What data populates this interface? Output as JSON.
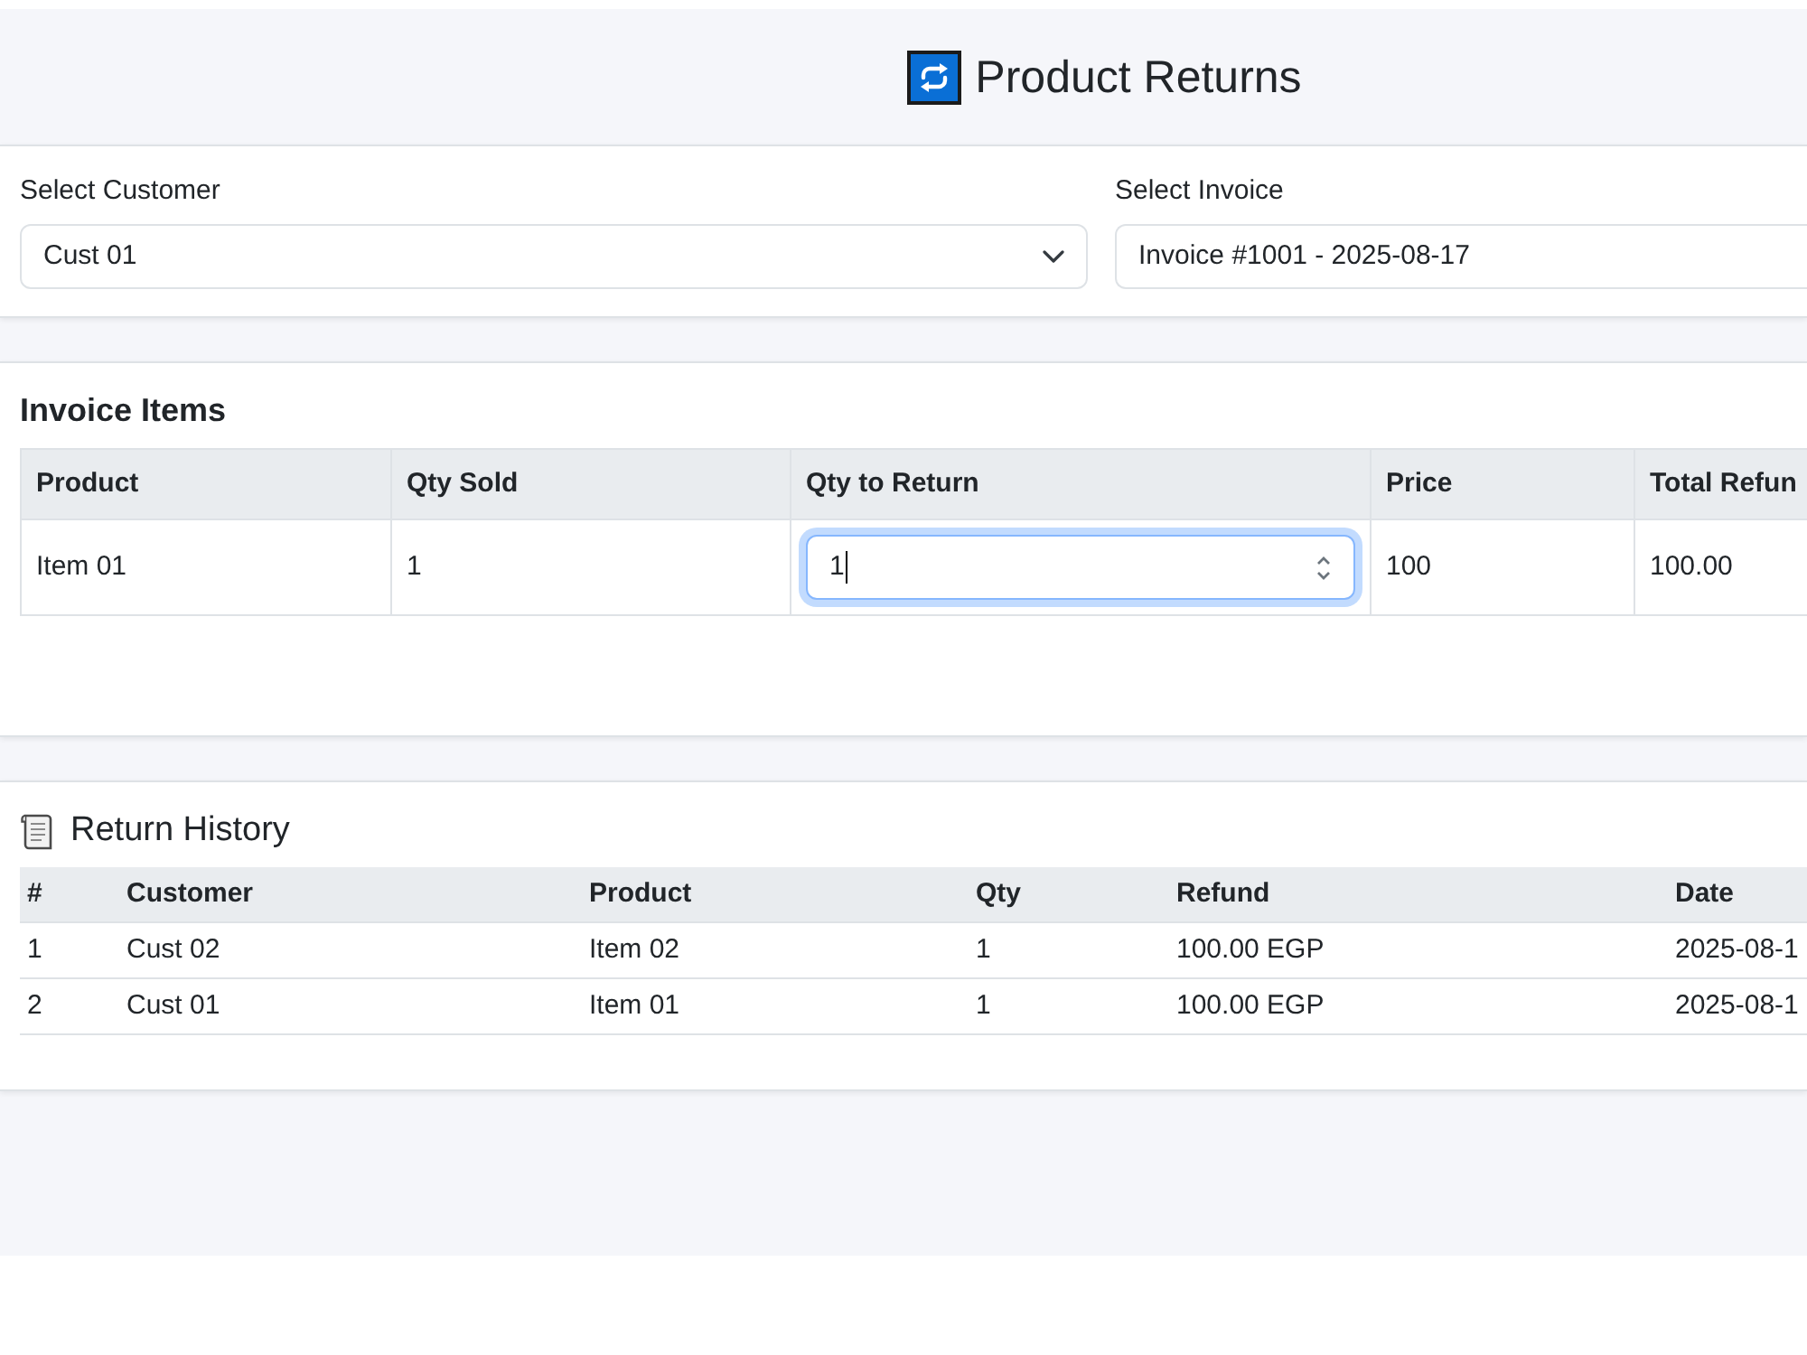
{
  "header": {
    "title": "Product Returns"
  },
  "filters": [
    {
      "label": "Select Customer",
      "value": "Cust 01"
    },
    {
      "label": "Select Invoice",
      "value": "Invoice #1001 - 2025-08-17"
    }
  ],
  "invoice_items": {
    "title": "Invoice Items",
    "columns": [
      "Product",
      "Qty Sold",
      "Qty to Return",
      "Price",
      "Total Refun"
    ],
    "rows": [
      {
        "cells": [
          {
            "kind": "text",
            "text": "Item 01"
          },
          {
            "kind": "text",
            "text": "1"
          },
          {
            "kind": "number_input",
            "value": "1",
            "focused": true
          },
          {
            "kind": "text",
            "text": "100"
          },
          {
            "kind": "text",
            "text": "100.00"
          }
        ]
      }
    ]
  },
  "return_history": {
    "title": "Return History",
    "columns": [
      "#",
      "Customer",
      "Product",
      "Qty",
      "Refund",
      "Date"
    ],
    "rows": [
      [
        "1",
        "Cust 02",
        "Item 02",
        "1",
        "100.00 EGP",
        "2025-08-1"
      ],
      [
        "2",
        "Cust 01",
        "Item 01",
        "1",
        "100.00 EGP",
        "2025-08-1"
      ]
    ]
  }
}
